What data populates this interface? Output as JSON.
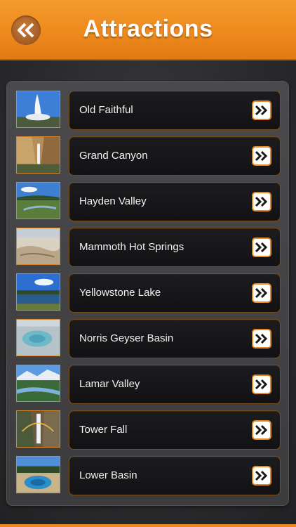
{
  "header": {
    "title": "Attractions",
    "back_icon": "double-chevron-left-icon",
    "color": "#ee8a1e"
  },
  "attractions": [
    {
      "name": "Old Faithful",
      "thumb": "geyser"
    },
    {
      "name": "Grand Canyon",
      "thumb": "canyon"
    },
    {
      "name": "Hayden Valley",
      "thumb": "valley"
    },
    {
      "name": "Mammoth Hot Springs",
      "thumb": "springs"
    },
    {
      "name": "Yellowstone Lake",
      "thumb": "lake"
    },
    {
      "name": "Norris Geyser Basin",
      "thumb": "basin"
    },
    {
      "name": "Lamar Valley",
      "thumb": "river"
    },
    {
      "name": "Tower Fall",
      "thumb": "waterfall"
    },
    {
      "name": "Lower Basin",
      "thumb": "pool"
    }
  ],
  "row_icon": "double-chevron-right-icon",
  "accent": "#e68a22"
}
